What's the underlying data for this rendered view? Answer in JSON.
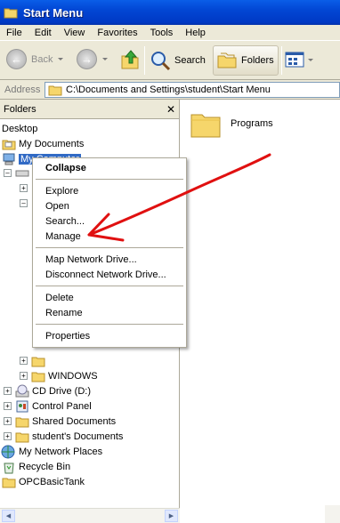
{
  "window": {
    "title": "Start Menu"
  },
  "menubar": {
    "items": [
      "File",
      "Edit",
      "View",
      "Favorites",
      "Tools",
      "Help"
    ]
  },
  "toolbar": {
    "back_label": "Back",
    "search_label": "Search",
    "folders_label": "Folders"
  },
  "address": {
    "label": "Address",
    "value": "C:\\Documents and Settings\\student\\Start Menu"
  },
  "folders_pane": {
    "title": "Folders",
    "tree": [
      "Desktop",
      "My Documents",
      "My Computer",
      "WINDOWS",
      "CD Drive (D:)",
      "Control Panel",
      "Shared Documents",
      "student's Documents",
      "My Network Places",
      "Recycle Bin",
      "OPCBasicTank"
    ]
  },
  "content": {
    "items": [
      "Programs"
    ]
  },
  "context_menu": {
    "items": [
      "Collapse",
      "Explore",
      "Open",
      "Search...",
      "Manage",
      "Map Network Drive...",
      "Disconnect Network Drive...",
      "Delete",
      "Rename",
      "Properties"
    ]
  },
  "annotation": {
    "color": "#e01010"
  },
  "colors": {
    "titlebar": "#0246d4",
    "selection": "#316ac5",
    "chrome": "#ece9d8"
  }
}
